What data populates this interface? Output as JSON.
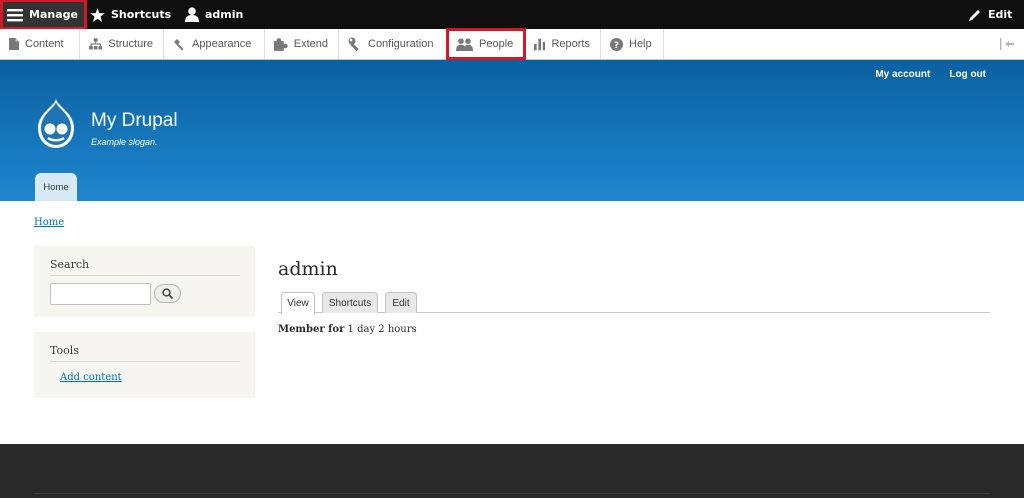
{
  "toolbar": {
    "manage_label": "Manage",
    "shortcuts_label": "Shortcuts",
    "user_label": "admin",
    "edit_label": "Edit"
  },
  "tray": {
    "items": [
      {
        "label": "Content",
        "icon": "page-icon"
      },
      {
        "label": "Structure",
        "icon": "sitemap-icon"
      },
      {
        "label": "Appearance",
        "icon": "paintbrush-icon"
      },
      {
        "label": "Extend",
        "icon": "puzzle-icon"
      },
      {
        "label": "Configuration",
        "icon": "wrench-icon"
      },
      {
        "label": "People",
        "icon": "people-icon"
      },
      {
        "label": "Reports",
        "icon": "bar-chart-icon"
      },
      {
        "label": "Help",
        "icon": "help-icon"
      }
    ]
  },
  "header": {
    "secondary_menu": [
      "My account",
      "Log out"
    ],
    "site_name": "My Drupal",
    "slogan": "Example slogan.",
    "primary_tab": "Home"
  },
  "breadcrumb": "Home",
  "sidebar": {
    "search_title": "Search",
    "search_value": "",
    "tools_title": "Tools",
    "tools_link": "Add content"
  },
  "main": {
    "title": "admin",
    "tabs": [
      "View",
      "Shortcuts",
      "Edit"
    ],
    "member_label": "Member for",
    "member_value": "1 day 2 hours"
  },
  "colors": {
    "toolbar_bg": "#0f0f0f",
    "header_top": "#0b60a0",
    "header_bottom": "#1e87cf",
    "link": "#0071b3",
    "highlight": "#d21a26",
    "footer_bg": "#292929"
  }
}
